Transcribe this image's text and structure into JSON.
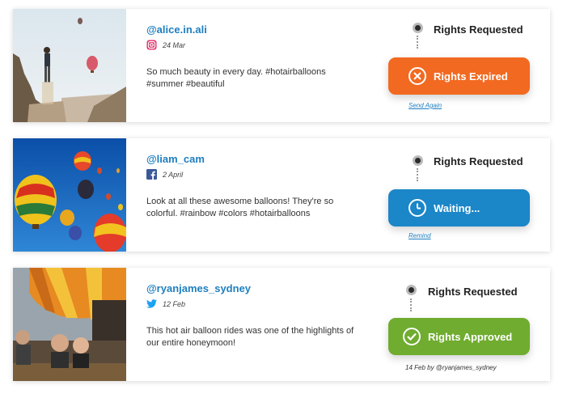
{
  "posts": [
    {
      "handle": "@alice.in.ali",
      "network_icon": "instagram-icon",
      "date": "24 Mar",
      "caption": "So much beauty in every day. #hotairballoons #summer #beautiful",
      "requested_label": "Rights Requested",
      "status_label": "Rights Expired",
      "status_color": "#f26a21",
      "status_icon": "close-circle-icon",
      "action_label": "Send Again"
    },
    {
      "handle": "@liam_cam",
      "network_icon": "facebook-icon",
      "date": "2 April",
      "caption": "Look at all these awesome balloons! They're so colorful. #rainbow #colors #hotairballoons",
      "requested_label": "Rights Requested",
      "status_label": "Waiting...",
      "status_color": "#1b86c8",
      "status_icon": "clock-icon",
      "action_label": "Remind"
    },
    {
      "handle": "@ryanjames_sydney",
      "network_icon": "twitter-icon",
      "date": "12 Feb",
      "caption": "This hot air balloon rides was one of the highlights of our entire honeymoon!",
      "requested_label": "Rights Requested",
      "status_label": "Rights Approved",
      "status_color": "#6fac2f",
      "status_icon": "check-circle-icon",
      "approved_note": "14 Feb by @ryanjames_sydney"
    }
  ]
}
